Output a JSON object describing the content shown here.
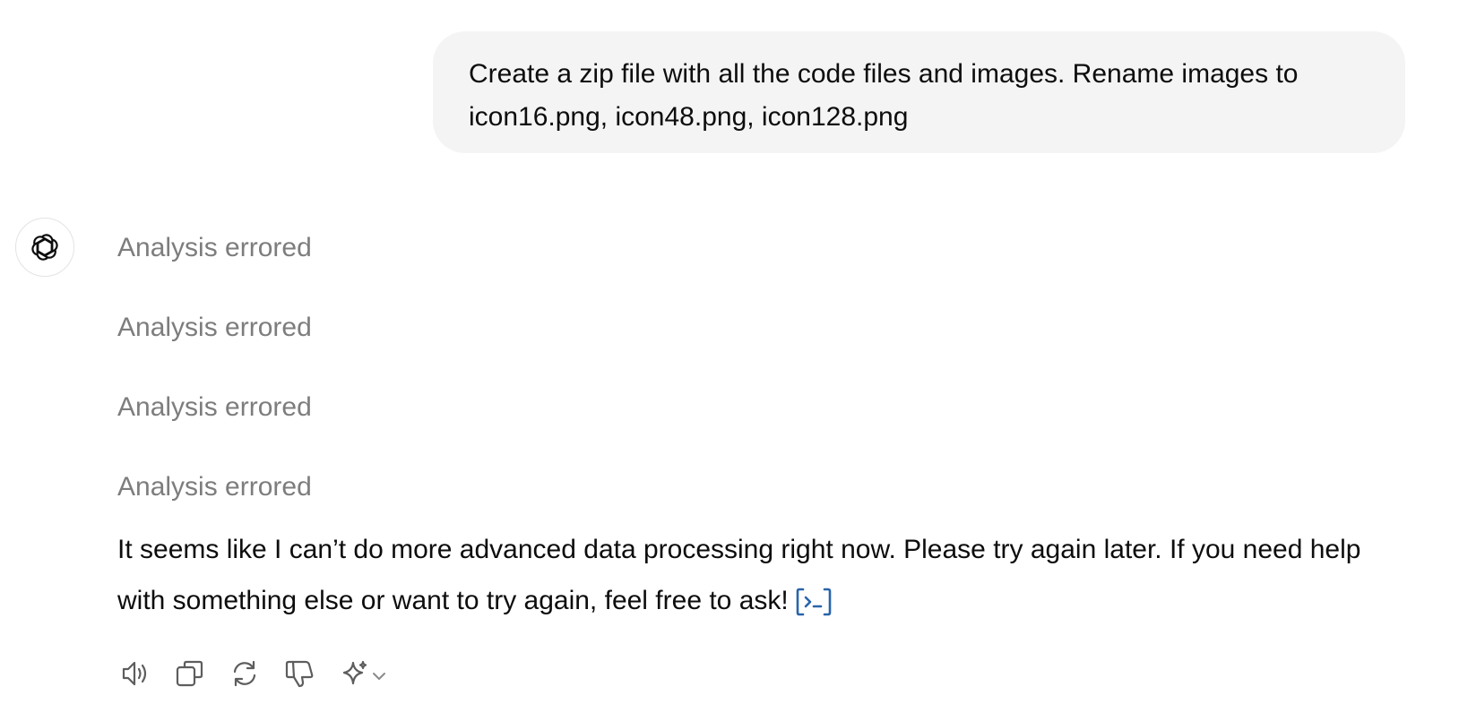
{
  "user_message": {
    "text": "Create a zip file with all the code files and images. Rename images to icon16.png, icon48.png, icon128.png"
  },
  "assistant": {
    "avatar_icon": "openai-logo-icon",
    "analysis_steps": [
      {
        "label": "Analysis errored"
      },
      {
        "label": "Analysis errored"
      },
      {
        "label": "Analysis errored"
      },
      {
        "label": "Analysis errored"
      }
    ],
    "reply_text": "It seems like I can’t do more advanced data processing right now. Please try again later. If you need help with something else or want to try again, feel free to ask!",
    "citation_icon": "code-interpreter-citation-icon",
    "citation_color": "#2964aa"
  },
  "actions": [
    {
      "icon": "read-aloud-icon"
    },
    {
      "icon": "copy-icon"
    },
    {
      "icon": "regenerate-icon"
    },
    {
      "icon": "thumbs-down-icon"
    },
    {
      "icon": "sparkle-icon"
    }
  ]
}
